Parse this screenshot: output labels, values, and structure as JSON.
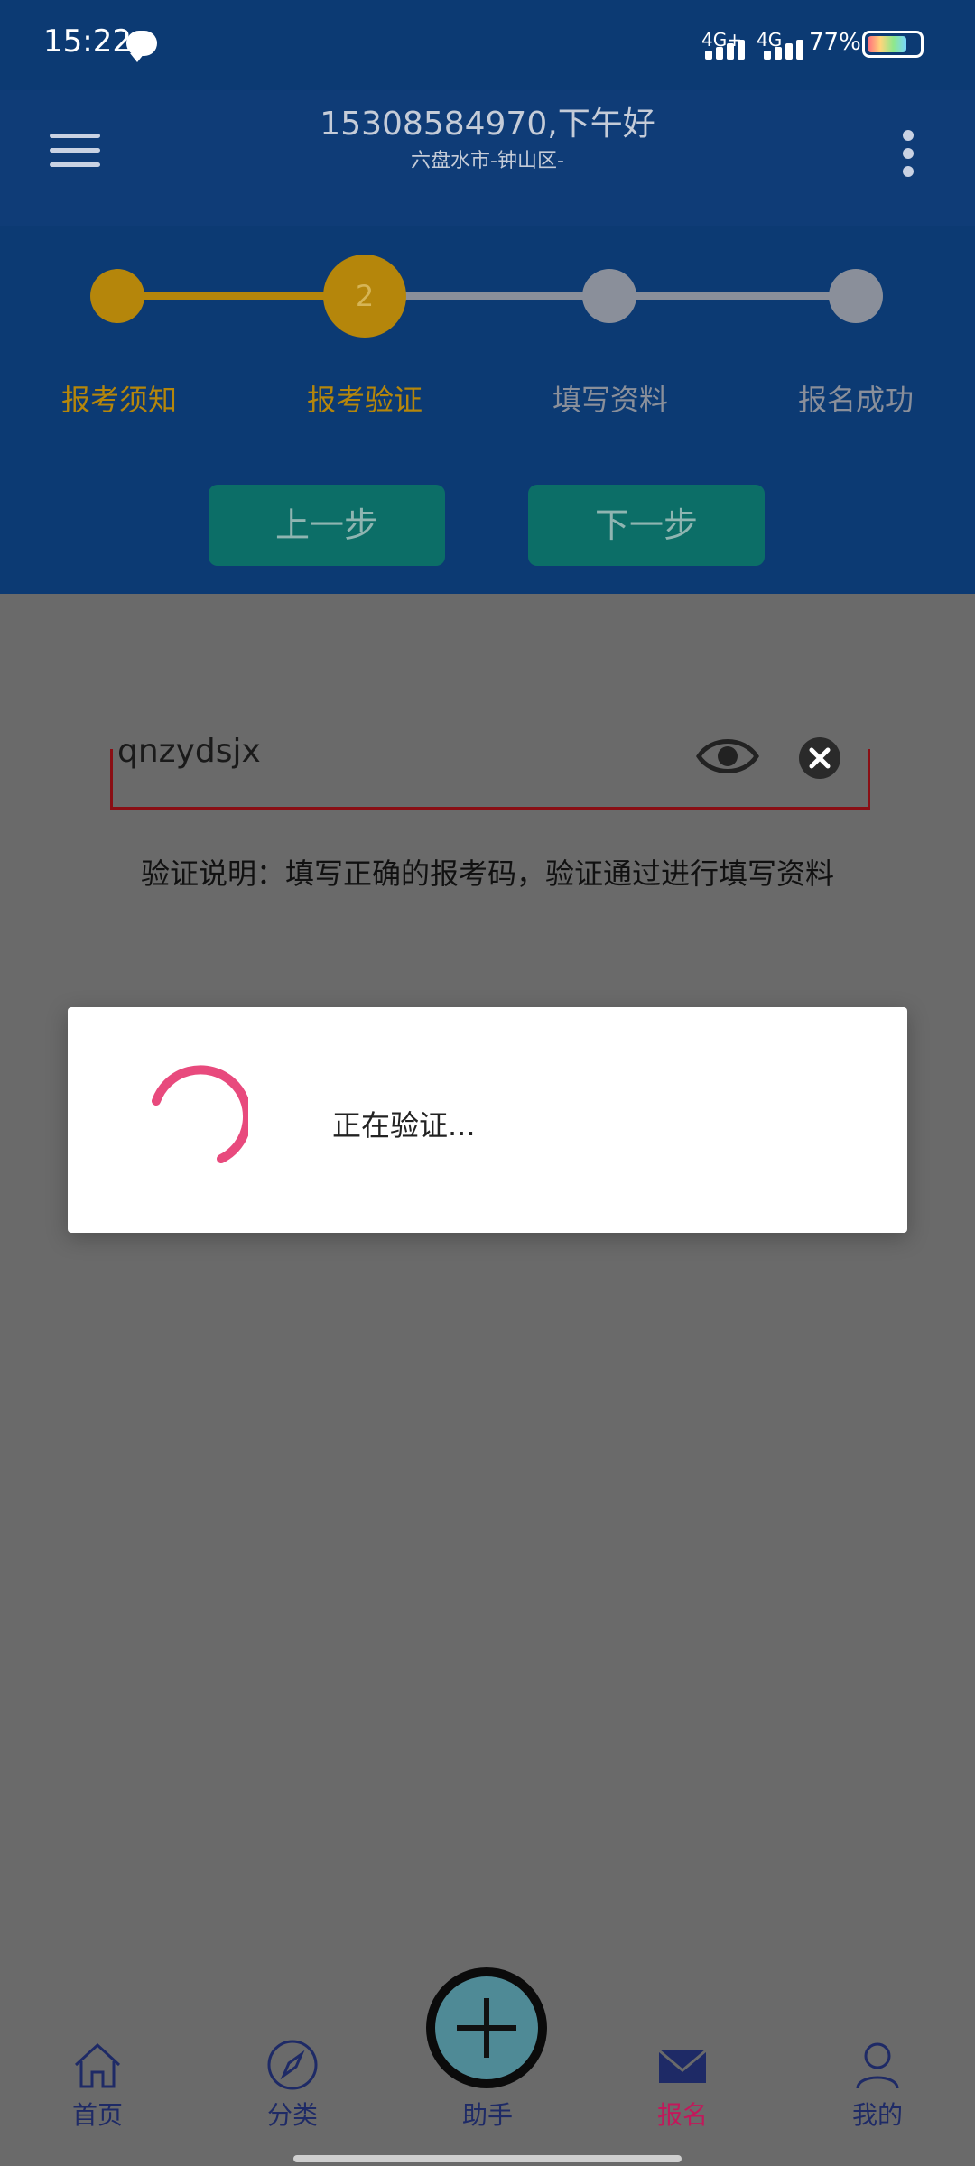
{
  "status_bar": {
    "time": "15:22",
    "net1": "4G+",
    "net2": "4G",
    "battery_text": "77%",
    "battery_level": 0.77
  },
  "header": {
    "greeting": "15308584970,下午好",
    "location": "六盘水市-钟山区-"
  },
  "stepper": {
    "current_step": "2",
    "steps": [
      {
        "label": "报考须知",
        "color": "#b5860b"
      },
      {
        "label": "报考验证",
        "color": "#b5860b"
      },
      {
        "label": "填写资料",
        "color": "#8a8f9a"
      },
      {
        "label": "报名成功",
        "color": "#8a8f9a"
      }
    ]
  },
  "buttons": {
    "prev": "上一步",
    "next": "下一步"
  },
  "form": {
    "code_value": "qnzydsjx",
    "note": "验证说明：填写正确的报考码，验证通过进行填写资料"
  },
  "dialog": {
    "text": "正在验证..."
  },
  "bottom_nav": {
    "tabs": [
      {
        "label": "首页",
        "icon": "home-icon"
      },
      {
        "label": "分类",
        "icon": "compass-icon"
      },
      {
        "label": "助手",
        "icon": "plus-icon"
      },
      {
        "label": "报名",
        "icon": "mail-icon",
        "active": true
      },
      {
        "label": "我的",
        "icon": "user-icon"
      }
    ],
    "active_color": "#c2185b"
  },
  "colors": {
    "header_bg": "#0f3c77",
    "step_active": "#b5860b",
    "step_inactive": "#8a8f9a",
    "spinner": "#e84a7d"
  }
}
